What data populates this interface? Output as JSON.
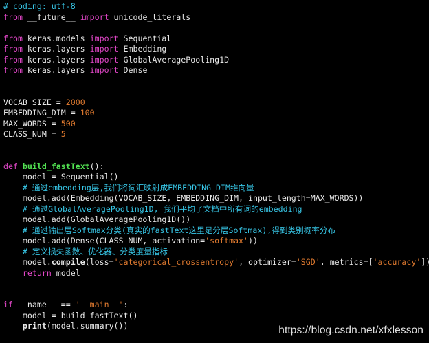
{
  "colors": {
    "background": "#000000",
    "keyword": "#e247c8",
    "comment": "#37c6e6",
    "number_string": "#e07a2f",
    "function_name": "#52e252",
    "plain": "#e8e8e8"
  },
  "code_lines": [
    [
      {
        "t": "cmt",
        "v": "# coding: utf-8"
      }
    ],
    [
      {
        "t": "kw",
        "v": "from"
      },
      {
        "t": "plain",
        "v": " __future__ "
      },
      {
        "t": "kw",
        "v": "import"
      },
      {
        "t": "plain",
        "v": " unicode_literals"
      }
    ],
    [],
    [
      {
        "t": "kw",
        "v": "from"
      },
      {
        "t": "plain",
        "v": " keras.models "
      },
      {
        "t": "kw",
        "v": "import"
      },
      {
        "t": "plain",
        "v": " Sequential"
      }
    ],
    [
      {
        "t": "kw",
        "v": "from"
      },
      {
        "t": "plain",
        "v": " keras.layers "
      },
      {
        "t": "kw",
        "v": "import"
      },
      {
        "t": "plain",
        "v": " Embedding"
      }
    ],
    [
      {
        "t": "kw",
        "v": "from"
      },
      {
        "t": "plain",
        "v": " keras.layers "
      },
      {
        "t": "kw",
        "v": "import"
      },
      {
        "t": "plain",
        "v": " GlobalAveragePooling1D"
      }
    ],
    [
      {
        "t": "kw",
        "v": "from"
      },
      {
        "t": "plain",
        "v": " keras.layers "
      },
      {
        "t": "kw",
        "v": "import"
      },
      {
        "t": "plain",
        "v": " Dense"
      }
    ],
    [],
    [],
    [
      {
        "t": "plain",
        "v": "VOCAB_SIZE = "
      },
      {
        "t": "num",
        "v": "2000"
      }
    ],
    [
      {
        "t": "plain",
        "v": "EMBEDDING_DIM = "
      },
      {
        "t": "num",
        "v": "100"
      }
    ],
    [
      {
        "t": "plain",
        "v": "MAX_WORDS = "
      },
      {
        "t": "num",
        "v": "500"
      }
    ],
    [
      {
        "t": "plain",
        "v": "CLASS_NUM = "
      },
      {
        "t": "num",
        "v": "5"
      }
    ],
    [],
    [],
    [
      {
        "t": "kw",
        "v": "def"
      },
      {
        "t": "plain",
        "v": " "
      },
      {
        "t": "fn",
        "v": "build_fastText"
      },
      {
        "t": "plain",
        "v": "():"
      }
    ],
    [
      {
        "t": "plain",
        "v": "    model = Sequential()"
      }
    ],
    [
      {
        "t": "plain",
        "v": "    "
      },
      {
        "t": "cmt",
        "v": "# 通过embedding层,我们将词汇映射成EMBEDDING_DIM维向量"
      }
    ],
    [
      {
        "t": "plain",
        "v": "    model.add(Embedding(VOCAB_SIZE, EMBEDDING_DIM, input_length=MAX_WORDS))"
      }
    ],
    [
      {
        "t": "plain",
        "v": "    "
      },
      {
        "t": "cmt",
        "v": "# 通过GlobalAveragePooling1D, 我们平均了文档中所有词的embedding"
      }
    ],
    [
      {
        "t": "plain",
        "v": "    model.add(GlobalAveragePooling1D())"
      }
    ],
    [
      {
        "t": "plain",
        "v": "    "
      },
      {
        "t": "cmt",
        "v": "# 通过输出层Softmax分类(真实的fastText这里是分层Softmax),得到类别概率分布"
      }
    ],
    [
      {
        "t": "plain",
        "v": "    model.add(Dense(CLASS_NUM, activation="
      },
      {
        "t": "str",
        "v": "'softmax'"
      },
      {
        "t": "plain",
        "v": "))"
      }
    ],
    [
      {
        "t": "plain",
        "v": "    "
      },
      {
        "t": "cmt",
        "v": "# 定义损失函数、优化器、分类度量指标"
      }
    ],
    [
      {
        "t": "plain",
        "v": "    model."
      },
      {
        "t": "builtin",
        "v": "compile"
      },
      {
        "t": "plain",
        "v": "(loss="
      },
      {
        "t": "str",
        "v": "'categorical_crossentropy'"
      },
      {
        "t": "plain",
        "v": ", optimizer="
      },
      {
        "t": "str",
        "v": "'SGD'"
      },
      {
        "t": "plain",
        "v": ", metrics=["
      },
      {
        "t": "str",
        "v": "'accuracy'"
      },
      {
        "t": "plain",
        "v": "])"
      }
    ],
    [
      {
        "t": "plain",
        "v": "    "
      },
      {
        "t": "kw",
        "v": "return"
      },
      {
        "t": "plain",
        "v": " model"
      }
    ],
    [],
    [],
    [
      {
        "t": "kw",
        "v": "if"
      },
      {
        "t": "plain",
        "v": " __name__ == "
      },
      {
        "t": "str",
        "v": "'__main__'"
      },
      {
        "t": "plain",
        "v": ":"
      }
    ],
    [
      {
        "t": "plain",
        "v": "    model = build_fastText()"
      }
    ],
    [
      {
        "t": "plain",
        "v": "    "
      },
      {
        "t": "builtin",
        "v": "print"
      },
      {
        "t": "plain",
        "v": "(model.summary())"
      }
    ]
  ],
  "watermark": "https://blog.csdn.net/xfxlesson"
}
